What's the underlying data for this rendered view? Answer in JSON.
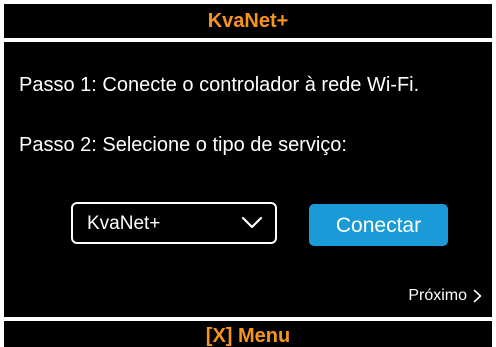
{
  "header": {
    "title": "KvaNet+"
  },
  "steps": {
    "step1": "Passo 1: Conecte o controlador à rede Wi-Fi.",
    "step2": "Passo 2: Selecione o tipo de serviço:"
  },
  "service_select": {
    "selected": "KvaNet+",
    "icon": "chevron-down-icon"
  },
  "connect_button": {
    "label": "Conectar"
  },
  "next_link": {
    "label": "Próximo",
    "icon": "chevron-right-icon"
  },
  "footer": {
    "label": "[X] Menu"
  },
  "colors": {
    "accent": "#f7941d",
    "button": "#1a9ad6",
    "background": "#000000",
    "text": "#ffffff"
  }
}
